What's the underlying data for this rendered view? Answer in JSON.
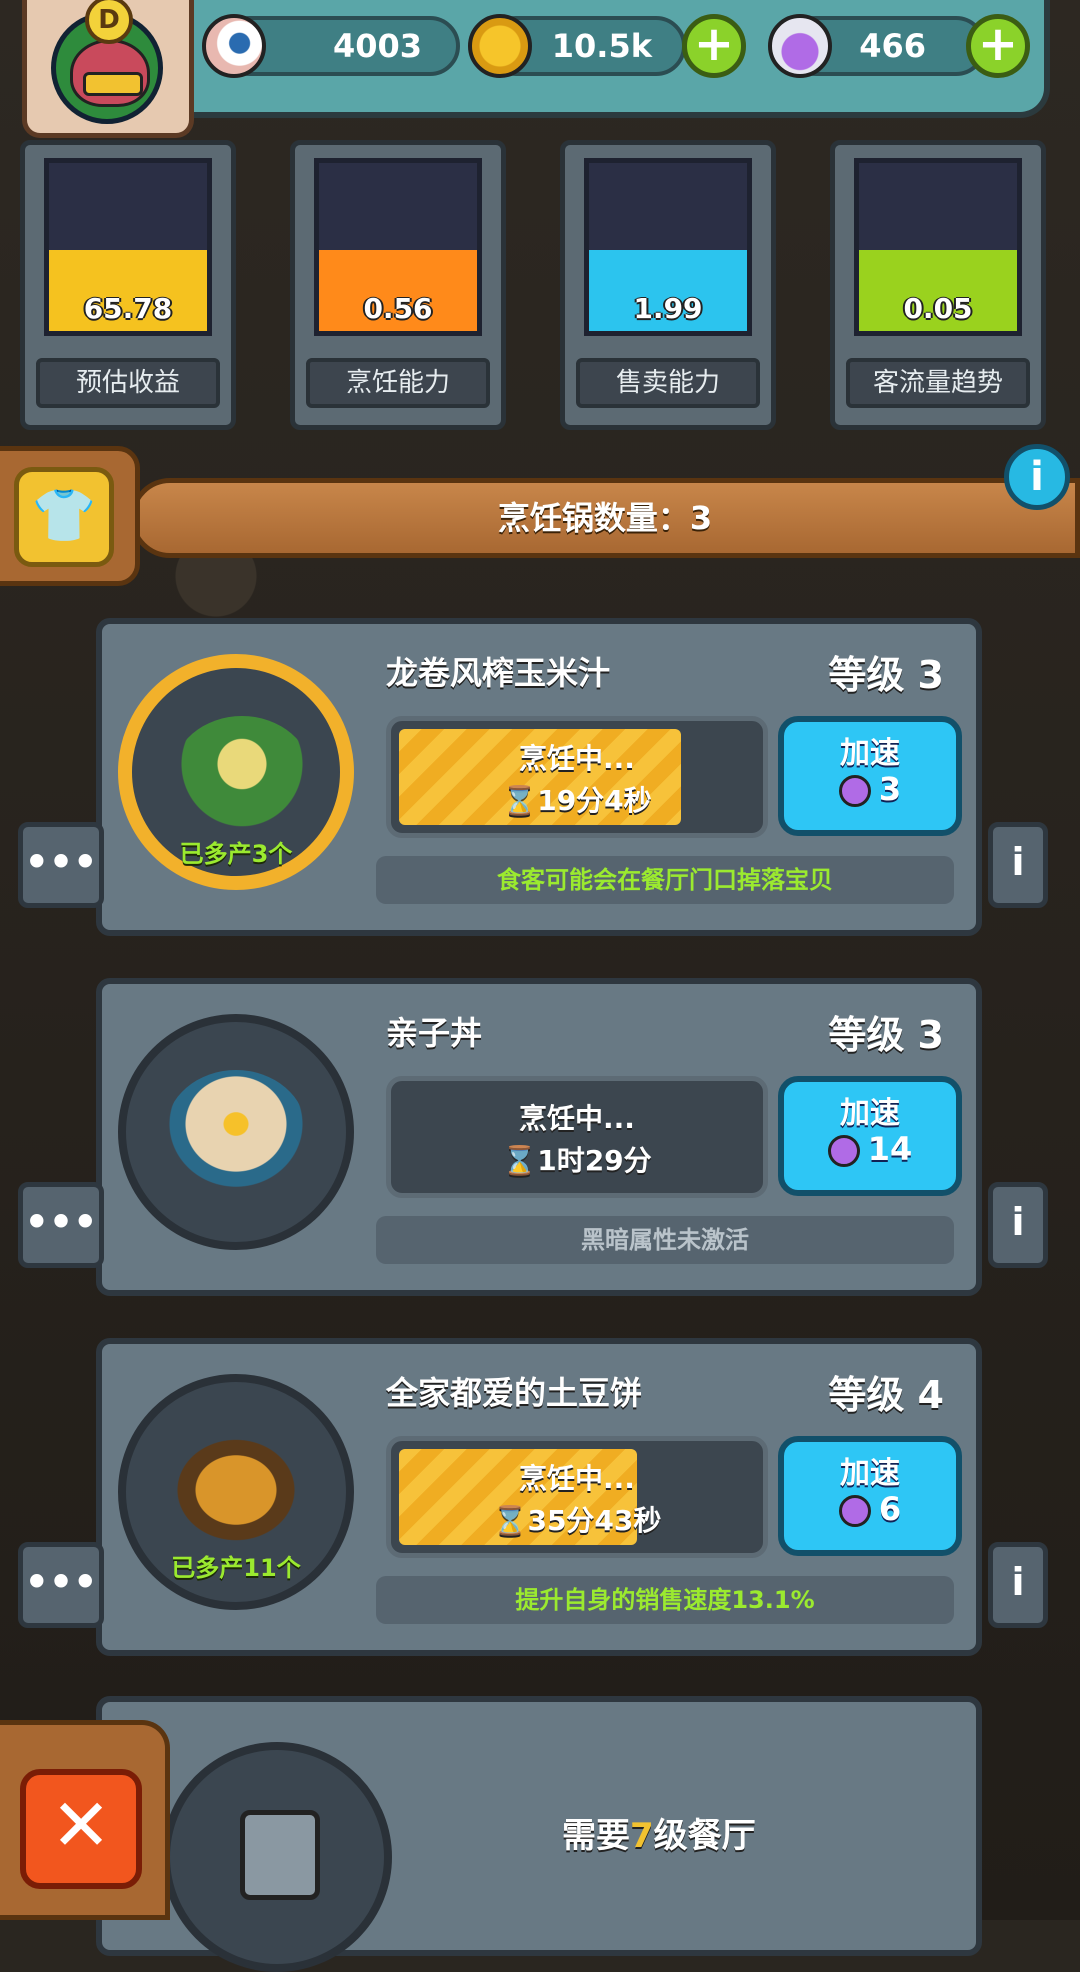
{
  "top_bar": {
    "eyeballs": "4003",
    "coins": "10.5k",
    "potions": "466",
    "avatar_badge": "D"
  },
  "stats": [
    {
      "label": "预估收益",
      "value": "65.78",
      "fill": 0.48,
      "color": "#f5c21f"
    },
    {
      "label": "烹饪能力",
      "value": "0.56",
      "fill": 0.48,
      "color": "#ff8a1a"
    },
    {
      "label": "售卖能力",
      "value": "1.99",
      "fill": 0.48,
      "color": "#2cc4ee"
    },
    {
      "label": "客流量趋势",
      "value": "0.05",
      "fill": 0.48,
      "color": "#9ad21e"
    }
  ],
  "banner": {
    "text": "烹饪锅数量：3"
  },
  "cards": [
    {
      "name": "龙卷风榨玉米汁",
      "level": "等级 3",
      "status": "烹饪中...",
      "time": "⌛19分4秒",
      "progress": 0.78,
      "speed_label": "加速",
      "speed_cost": "3",
      "produced": "已多产3个",
      "hint": "食客可能会在餐厅门口掉落宝贝",
      "hint_color": "#9bea2f",
      "ring_active": true
    },
    {
      "name": "亲子丼",
      "level": "等级 3",
      "status": "烹饪中...",
      "time": "⌛1时29分",
      "progress": 0.0,
      "speed_label": "加速",
      "speed_cost": "14",
      "produced": "",
      "hint": "黑暗属性未激活",
      "hint_color": "#b9c3ca",
      "ring_active": false
    },
    {
      "name": "全家都爱的土豆饼",
      "level": "等级 4",
      "status": "烹饪中...",
      "time": "⌛35分43秒",
      "progress": 0.66,
      "speed_label": "加速",
      "speed_cost": "6",
      "produced": "已多产11个",
      "hint": "提升自身的销售速度13.1%",
      "hint_color": "#9bea2f",
      "ring_active": false
    }
  ],
  "locked": {
    "prefix": "需要",
    "number": "7",
    "suffix": "级餐厅"
  }
}
